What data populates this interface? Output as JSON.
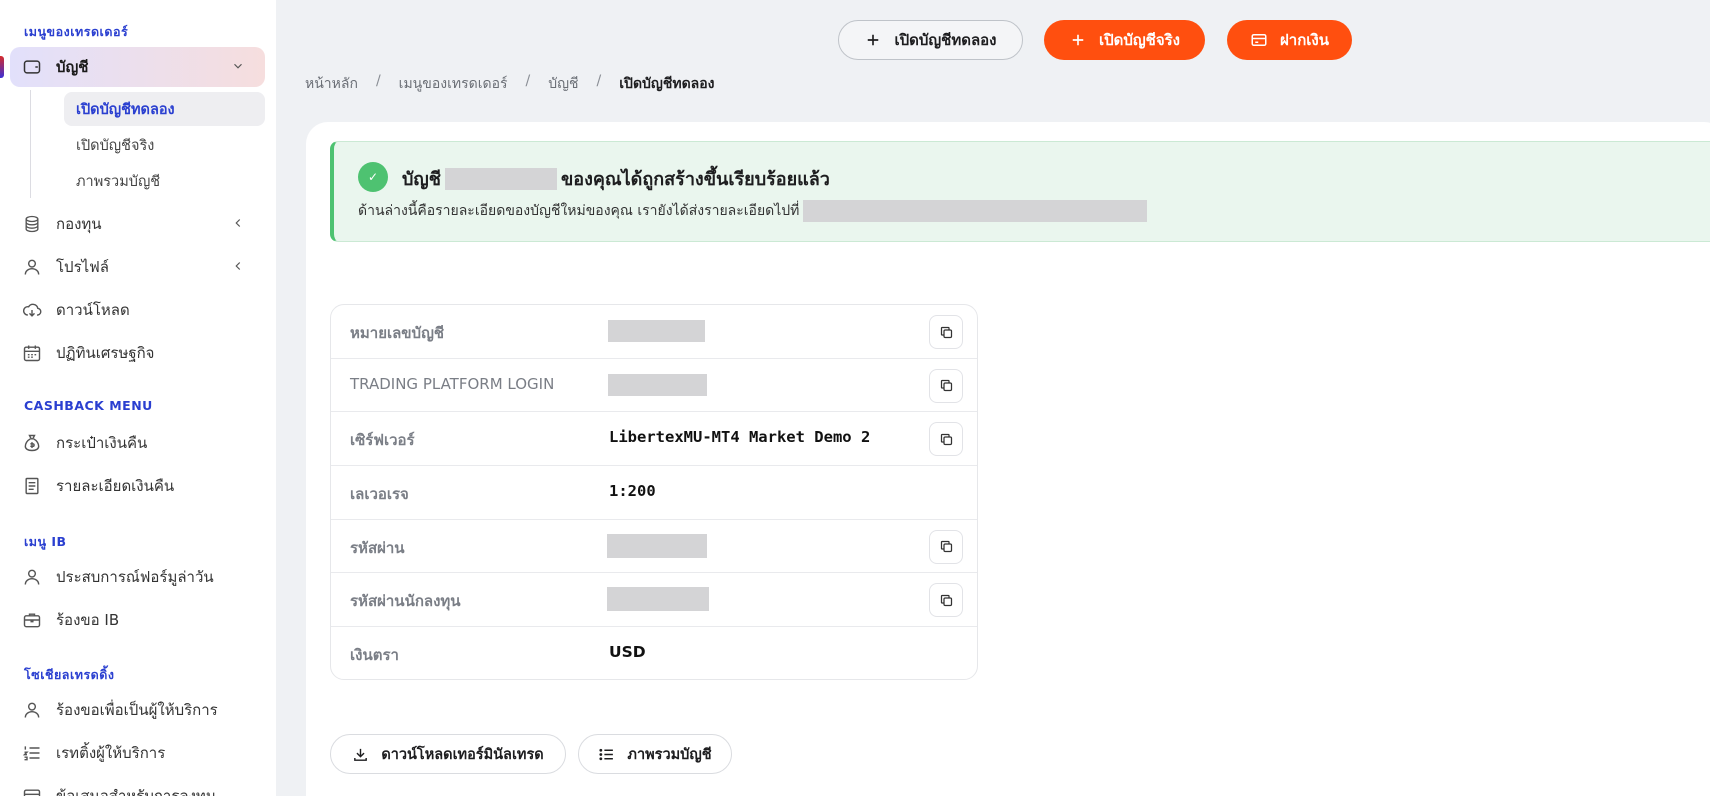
{
  "sidebar": {
    "sections": {
      "trader_menu": "เมนูของเทรดเดอร์",
      "cashback_menu": "CASHBACK MENU",
      "ib_menu": "เมนู IB",
      "social_trading": "โซเชียลเทรดดิ้ง"
    },
    "items": {
      "account": "บัญชี",
      "funds": "กองทุน",
      "profile": "โปรไฟล์",
      "download": "ดาวน์โหลด",
      "calendar": "ปฏิทินเศรษฐกิจ",
      "cashback_wallet": "กระเป๋าเงินคืน",
      "cashback_details": "รายละเอียดเงินคืน",
      "formula_experience": "ประสบการณ์ฟอร์มูล่าวัน",
      "request_ib": "ร้องขอ IB",
      "request_provider": "ร้องขอเพื่อเป็นผู้ให้บริการ",
      "provider_ranking": "เรทติ้งผู้ให้บริการ",
      "investor_info": "ข้อเสนอสำหรับการลงทุน"
    },
    "sub_items": {
      "open_demo": "เปิดบัญชีทดลอง",
      "open_real": "เปิดบัญชีจริง",
      "overview": "ภาพรวมบัญชี"
    }
  },
  "header": {
    "open_demo_button": "เปิดบัญชีทดลอง",
    "open_real_button": "เปิดบัญชีจริง",
    "deposit_button": "ฝากเงิน"
  },
  "breadcrumb": {
    "home": "หน้าหลัก",
    "trader_menu": "เมนูของเทรดเดอร์",
    "account": "บัญชี",
    "current": "เปิดบัญชีทดลอง",
    "separator": "/"
  },
  "alert": {
    "title_prefix": "บัญชี",
    "title_suffix": "ของคุณได้ถูกสร้างขึ้นเรียบร้อยแล้ว",
    "description": "ด้านล่างนี้คือรายละเอียดของบัญชีใหม่ของคุณ เรายังได้ส่งรายละเอียดไปที่"
  },
  "details": {
    "account_number_label": "หมายเลขบัญชี",
    "platform_login_label": "TRADING PLATFORM LOGIN",
    "server_label": "เซิร์ฟเวอร์",
    "server_value": "LibertexMU-MT4 Market Demo 2",
    "leverage_label": "เลเวอเรจ",
    "leverage_value": "1:200",
    "password_label": "รหัสผ่าน",
    "investor_password_label": "รหัสผ่านนักลงทุน",
    "currency_label": "เงินตรา",
    "currency_value": "USD"
  },
  "actions": {
    "download_terminal": "ดาวน์โหลดเทอร์มินัลเทรด",
    "account_overview": "ภาพรวมบัญชี"
  },
  "colors": {
    "accent_orange": "#ff4f0f",
    "accent_blue": "#2a3fd0",
    "success_green": "#4ec271"
  }
}
